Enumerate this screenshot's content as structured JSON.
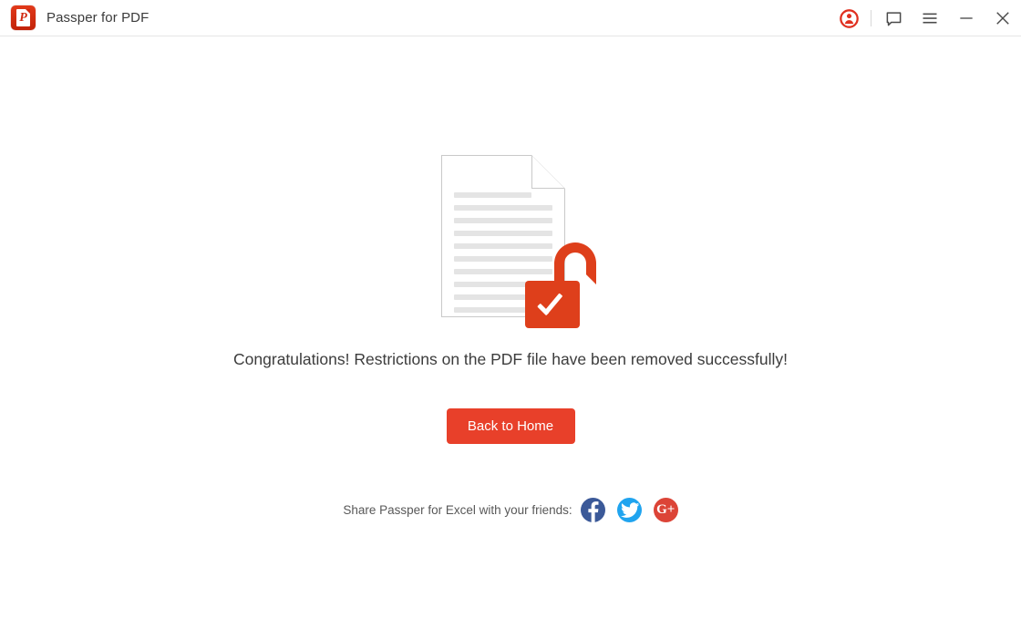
{
  "window": {
    "title": "Passper for PDF",
    "logo_icon": "passper-pdf-logo-icon",
    "logo_letter": "P",
    "accent_color": "#e8402a",
    "background_color": "#ffffff"
  },
  "titlebar": {
    "controls": [
      {
        "name": "account-icon",
        "label": "Account",
        "color": "#e03020"
      },
      {
        "name": "feedback-icon",
        "label": "Feedback",
        "color": "#4a4a4a"
      },
      {
        "name": "menu-icon",
        "label": "Menu",
        "color": "#4a4a4a"
      },
      {
        "name": "minimize-icon",
        "label": "Minimize",
        "color": "#4a4a4a"
      },
      {
        "name": "close-icon",
        "label": "Close",
        "color": "#4a4a4a"
      }
    ]
  },
  "main": {
    "illustration": {
      "name": "unlocked-document-illustration",
      "document_line_count": 10,
      "lock_state": "unlocked",
      "lock_color": "#de3f1b",
      "check_color": "#ffffff",
      "page_color": "#ffffff",
      "page_border_color": "#c9c9c9",
      "line_color": "#e4e4e4"
    },
    "message": "Congratulations! Restrictions on the PDF file have been removed successfully!",
    "primary_button": "Back to Home",
    "share": {
      "label": "Share Passper for Excel with your friends:",
      "networks": [
        {
          "name": "facebook",
          "glyph": "f",
          "color": "#3b5998"
        },
        {
          "name": "twitter",
          "glyph": "bird",
          "color": "#20a4ef"
        },
        {
          "name": "google-plus",
          "glyph": "G+",
          "color": "#dc4437"
        }
      ]
    }
  }
}
